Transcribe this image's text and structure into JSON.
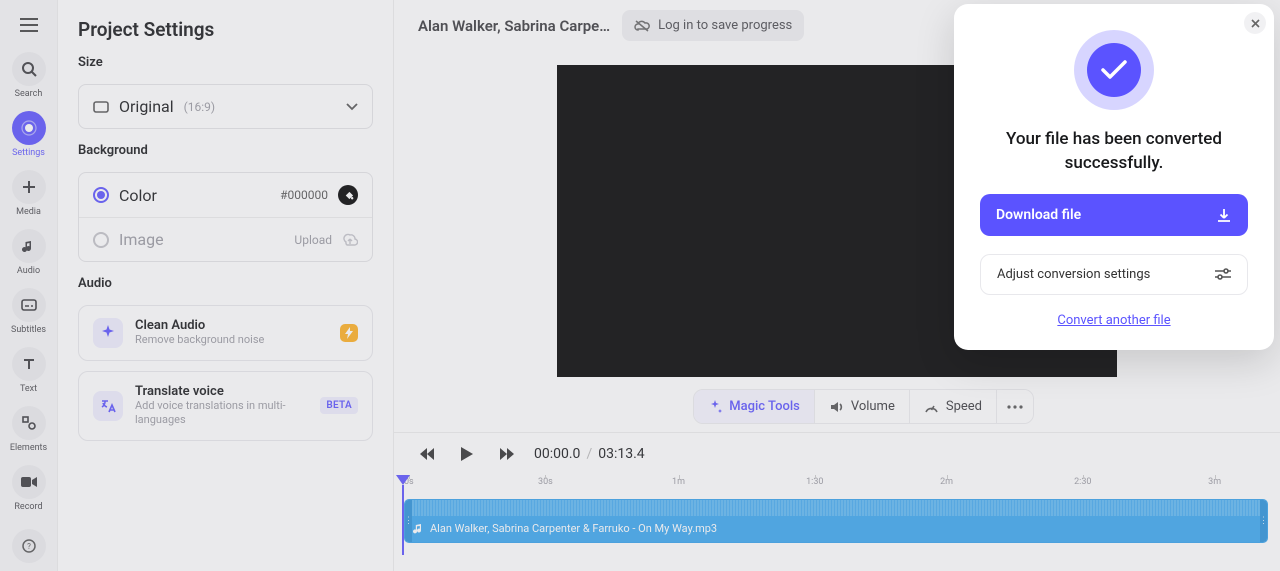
{
  "sidebar": {
    "items": [
      {
        "label": "Search"
      },
      {
        "label": "Settings"
      },
      {
        "label": "Media"
      },
      {
        "label": "Audio"
      },
      {
        "label": "Subtitles"
      },
      {
        "label": "Text"
      },
      {
        "label": "Elements"
      },
      {
        "label": "Record"
      }
    ]
  },
  "panel": {
    "title": "Project Settings",
    "size": {
      "label": "Size",
      "value": "Original",
      "aspect": "(16:9)"
    },
    "background": {
      "label": "Background",
      "color_label": "Color",
      "color_hex": "#000000",
      "image_label": "Image",
      "upload": "Upload"
    },
    "audio": {
      "label": "Audio",
      "clean": {
        "title": "Clean Audio",
        "sub": "Remove background noise"
      },
      "translate": {
        "title": "Translate voice",
        "sub": "Add voice translations in multi-languages",
        "badge": "BETA"
      }
    }
  },
  "header": {
    "project_name": "Alan Walker, Sabrina Carpe…",
    "login": "Log in to save progress"
  },
  "toolbar": {
    "magic": "Magic Tools",
    "volume": "Volume",
    "speed": "Speed"
  },
  "transport": {
    "current": "00:00.0",
    "sep": "/",
    "total": "03:13.4"
  },
  "timeline": {
    "labels": [
      "0s",
      "30s",
      "1m",
      "1:30",
      "2m",
      "2:30",
      "3m"
    ],
    "positions": [
      0,
      15.3,
      30.6,
      45.9,
      61.2,
      76.5,
      91.8
    ],
    "clip_name": "Alan Walker, Sabrina Carpenter & Farruko - On My Way.mp3"
  },
  "modal": {
    "message": "Your file has been converted successfully.",
    "download": "Download file",
    "adjust": "Adjust conversion settings",
    "another": "Convert another file"
  }
}
